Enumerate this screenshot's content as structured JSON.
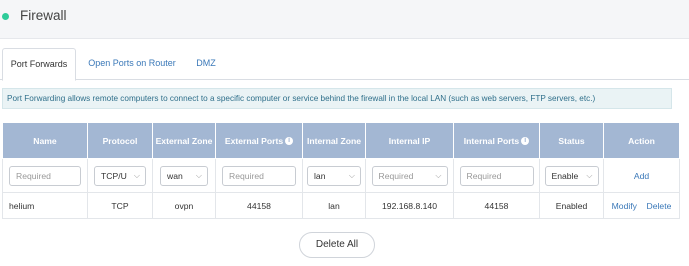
{
  "header": {
    "title": "Firewall"
  },
  "tabs": [
    {
      "label": "Port Forwards",
      "active": true
    },
    {
      "label": "Open Ports on Router",
      "active": false
    },
    {
      "label": "DMZ",
      "active": false
    }
  ],
  "notice": "Port Forwarding allows remote computers to connect to a specific computer or service behind the firewall in the local LAN (such as web servers, FTP servers, etc.)",
  "table": {
    "columns": [
      {
        "label": "Name"
      },
      {
        "label": "Protocol"
      },
      {
        "label": "External Zone"
      },
      {
        "label": "External Ports",
        "info": true
      },
      {
        "label": "Internal Zone"
      },
      {
        "label": "Internal IP"
      },
      {
        "label": "Internal Ports",
        "info": true
      },
      {
        "label": "Status"
      },
      {
        "label": "Action"
      }
    ],
    "input_row": {
      "name_placeholder": "Required",
      "protocol": "TCP/U",
      "external_zone": "wan",
      "external_ports_placeholder": "Required",
      "internal_zone": "lan",
      "internal_ip_placeholder": "Required",
      "internal_ports_placeholder": "Required",
      "status": "Enable",
      "action": "Add"
    },
    "rows": [
      {
        "name": "helium",
        "protocol": "TCP",
        "external_zone": "ovpn",
        "external_ports": "44158",
        "internal_zone": "lan",
        "internal_ip": "192.168.8.140",
        "internal_ports": "44158",
        "status": "Enabled",
        "modify": "Modify",
        "delete": "Delete"
      }
    ]
  },
  "delete_all": "Delete All",
  "icons": {
    "info": "info-icon",
    "chevron": "chevron-down-icon",
    "status_dot": "status-dot"
  },
  "colors": {
    "accent": "#2ecc9a",
    "header_bg": "#a3b7d3",
    "link": "#3a78b8",
    "notice_bg": "#eaf3f5"
  }
}
